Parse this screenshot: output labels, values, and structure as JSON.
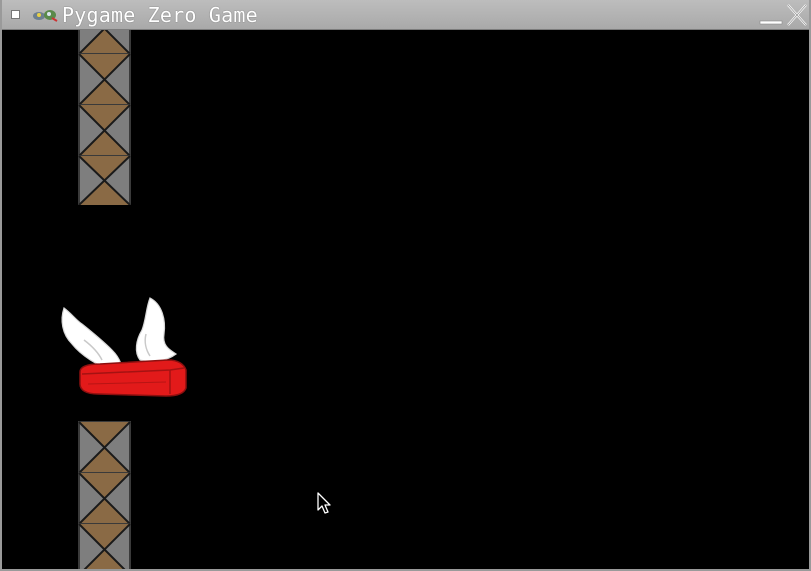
{
  "window": {
    "title": "Pygame Zero Game"
  },
  "icons": {
    "menu": "window-menu-icon",
    "app": "pygame-app-icon",
    "minimize": "minimize-icon",
    "close": "close-icon",
    "pointer": "mouse-pointer-icon"
  },
  "colors": {
    "titlebar": "#b3b3b3",
    "background": "#000000",
    "crate_brown": "#8a6a45",
    "crate_gray": "#7e7e7e",
    "player_red": "#e21a1a",
    "wing_white": "#ffffff"
  },
  "game": {
    "top_obstacle_crates": 4,
    "bottom_obstacle_crates": 3
  }
}
